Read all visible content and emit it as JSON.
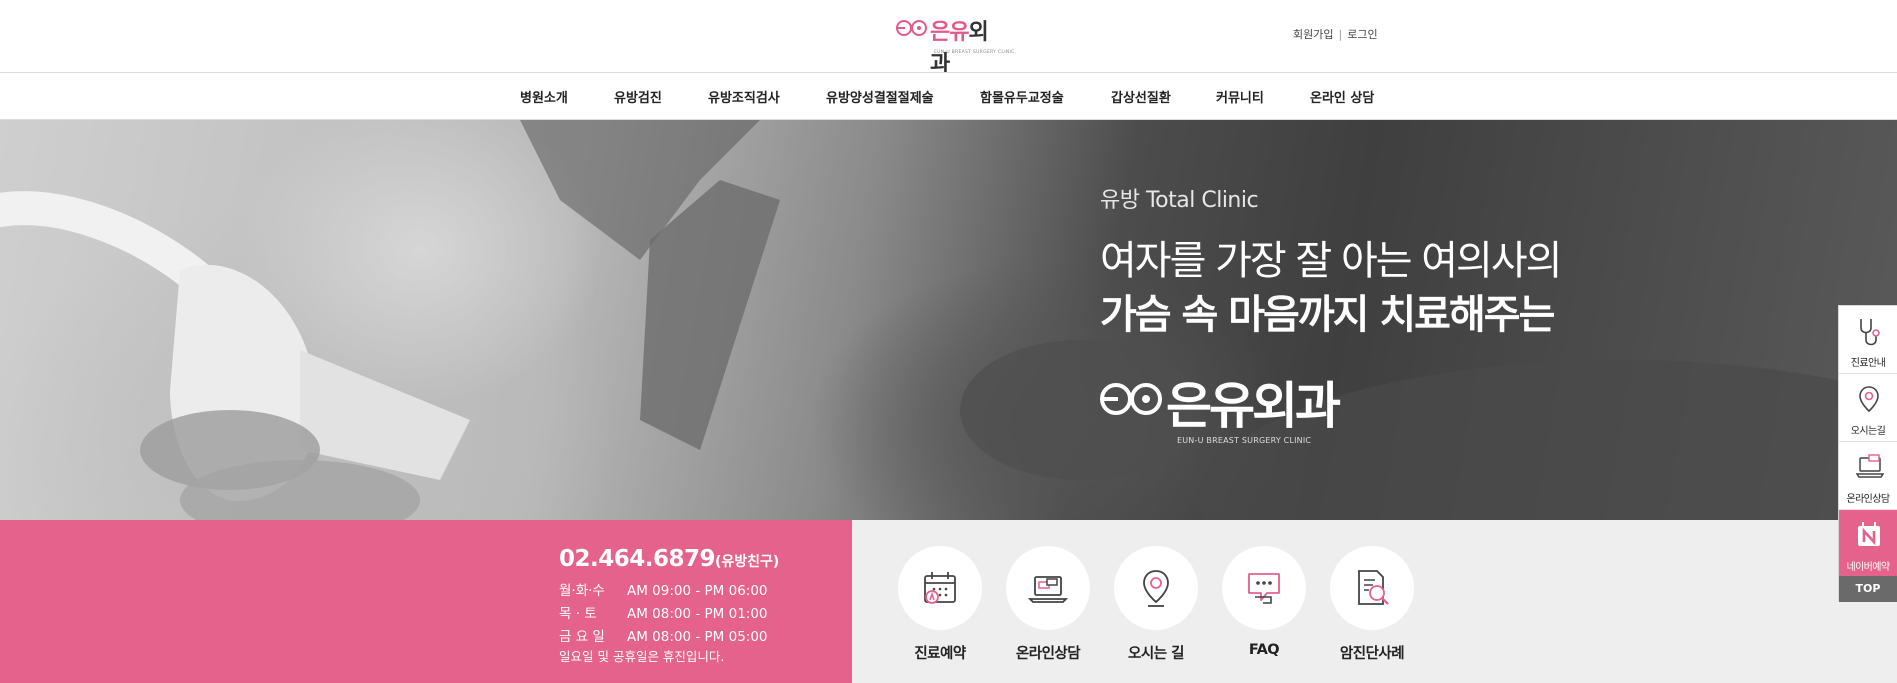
{
  "brand": {
    "logo_wordmark_pink": "은유",
    "logo_wordmark_dark": "외과",
    "logo_subtitle": "EUN-U BREAST SURGERY CLINIC",
    "accent_color": "#e4628b"
  },
  "util_links": {
    "signup": "회원가입",
    "separator": "|",
    "login": "로그인"
  },
  "nav": {
    "items": [
      "병원소개",
      "유방검진",
      "유방조직검사",
      "유방양성결절절제술",
      "함몰유두교정술",
      "갑상선질환",
      "커뮤니티",
      "온라인 상담"
    ]
  },
  "hero": {
    "eyebrow": "유방 Total Clinic",
    "headline_line1": "여자를 가장 잘 아는 여의사의",
    "headline_line2": "가슴 속 마음까지 치료해주는",
    "logo_wordmark": "은유외과",
    "logo_subtitle": "EUN-U BREAST SURGERY CLINIC"
  },
  "contact": {
    "phone": "02.464.6879",
    "phone_suffix": "(유방친구)",
    "hours": [
      {
        "days": "월·화·수",
        "time": "AM 09:00 - PM 06:00"
      },
      {
        "days": "목 · 토",
        "time": "AM 08:00 - PM 01:00"
      },
      {
        "days": "금 요 일",
        "time": "AM 08:00 - PM 05:00"
      }
    ],
    "note": "일요일 및 공휴일은 휴진입니다."
  },
  "quick_links": [
    {
      "label": "진료예약",
      "icon": "calendar-icon"
    },
    {
      "label": "온라인상담",
      "icon": "laptop-chat-icon"
    },
    {
      "label": "오시는 길",
      "icon": "map-pin-icon"
    },
    {
      "label": "FAQ",
      "icon": "speech-bubble-icon"
    },
    {
      "label": "암진단사례",
      "icon": "document-search-icon"
    }
  ],
  "side_menu": {
    "items": [
      {
        "label": "진료안내",
        "icon": "stethoscope-icon"
      },
      {
        "label": "오시는길",
        "icon": "map-pin-icon"
      },
      {
        "label": "온라인상담",
        "icon": "laptop-chat-icon"
      },
      {
        "label": "네이버예약",
        "icon": "naver-icon"
      }
    ],
    "top_label": "TOP"
  }
}
